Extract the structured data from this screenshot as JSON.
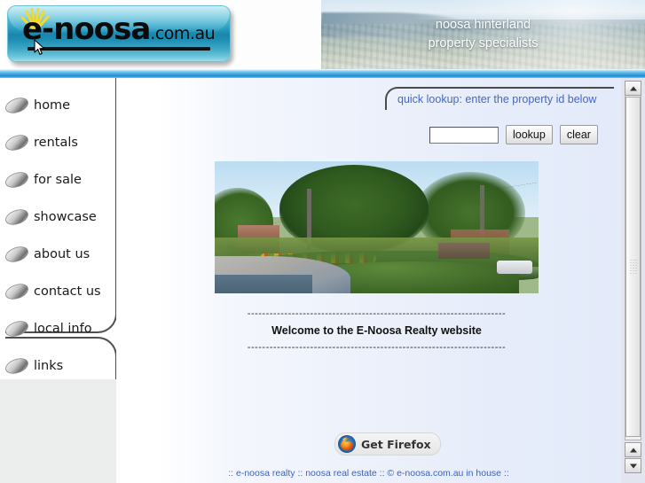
{
  "header": {
    "logo": {
      "brand": "e-noosa",
      "tld": ".com.au",
      "sun_icon": "sun-rays-icon"
    },
    "banner": {
      "line1": "noosa hinterland",
      "line2": "property specialists"
    }
  },
  "sidebar": {
    "items": [
      {
        "label": "home",
        "icon": "oval-bullet-icon"
      },
      {
        "label": "rentals",
        "icon": "oval-bullet-icon"
      },
      {
        "label": "for sale",
        "icon": "oval-bullet-icon"
      },
      {
        "label": "showcase",
        "icon": "oval-bullet-icon"
      },
      {
        "label": "about us",
        "icon": "oval-bullet-icon"
      },
      {
        "label": "contact us",
        "icon": "oval-bullet-icon"
      },
      {
        "label": "local info",
        "icon": "oval-bullet-icon"
      },
      {
        "label": "links",
        "icon": "oval-bullet-icon"
      }
    ]
  },
  "main": {
    "lookup": {
      "prompt": "quick lookup: enter the property id below",
      "input_value": "",
      "input_placeholder": "",
      "lookup_button": "lookup",
      "clear_button": "clear"
    },
    "hero_image_alt": "noosa street scene with large fig tree and gardens",
    "welcome": {
      "rule_top": "----------------------------------------------------------------------",
      "heading": "Welcome to the E-Noosa Realty website",
      "rule_bottom": "----------------------------------------------------------------------"
    },
    "firefox_badge": {
      "label": "Get Firefox",
      "icon": "firefox-logo-icon"
    },
    "footer": ":: e-noosa realty :: noosa real estate :: © e-noosa.com.au in house ::"
  },
  "scrollbar": {
    "up_arrow": "scroll-up-arrow-icon",
    "down_arrow": "scroll-down-arrow-icon"
  },
  "colors": {
    "link_blue": "#3c63bd",
    "prompt_blue": "#4169c8",
    "bar_blue": "#1f8ed1",
    "logo_teal": "#1a86ad"
  }
}
